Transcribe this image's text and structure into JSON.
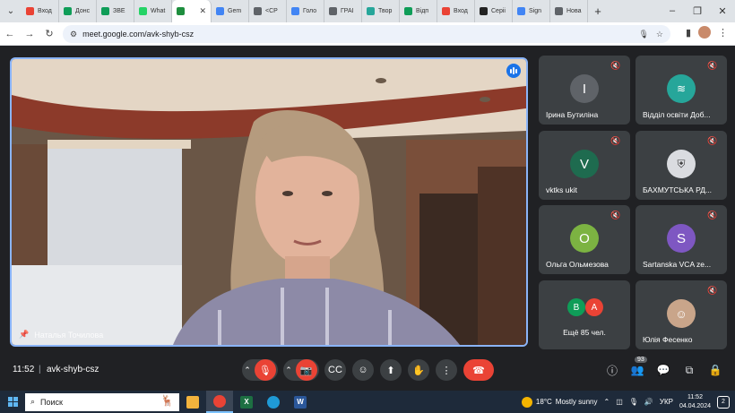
{
  "browser": {
    "tabs": [
      {
        "label": "Вход",
        "color": "#ea4335"
      },
      {
        "label": "Донс",
        "color": "#0f9d58"
      },
      {
        "label": "ЗВЕ",
        "color": "#0f9d58"
      },
      {
        "label": "What",
        "color": "#25d366"
      },
      {
        "label": "",
        "color": "#1e8e3e",
        "active": true
      },
      {
        "label": "Gem",
        "color": "#4285f4"
      },
      {
        "label": "<СР",
        "color": "#5f6368"
      },
      {
        "label": "Голо",
        "color": "#4285f4"
      },
      {
        "label": "ГРАІ",
        "color": "#5f6368"
      },
      {
        "label": "Твор",
        "color": "#26a69a"
      },
      {
        "label": "Відп",
        "color": "#0f9d58"
      },
      {
        "label": "Вход",
        "color": "#ea4335"
      },
      {
        "label": "Серіі",
        "color": "#222222"
      },
      {
        "label": "Sign",
        "color": "#4285f4"
      },
      {
        "label": "Нова",
        "color": "#5f6368"
      }
    ],
    "url": "meet.google.com/avk-shyb-csz"
  },
  "meeting": {
    "main_participant": "Наталья Точилова",
    "tiles": [
      {
        "name": "Ірина Бутиліна",
        "initial": "І",
        "color": "#5f6368"
      },
      {
        "name": "Відділ освіти Доб...",
        "initial": "",
        "color": "#26a69a"
      },
      {
        "name": "vktks ukit",
        "initial": "V",
        "color": "#1e6b4f"
      },
      {
        "name": "БАХМУТСЬКА РД...",
        "initial": "",
        "color": "#dadce0"
      },
      {
        "name": "Ольга Ольмезова",
        "initial": "О",
        "color": "#7cb342"
      },
      {
        "name": "Sartanska VCA ze...",
        "initial": "S",
        "color": "#7e57c2"
      },
      {
        "name": "Ещё 85 чел.",
        "initial": "",
        "color": ""
      },
      {
        "name": "Юлія Фесенко",
        "initial": "",
        "color": "#c9a58a"
      }
    ],
    "others_avatars": [
      {
        "initial": "В",
        "color": "#0f9d58"
      },
      {
        "initial": "А",
        "color": "#ea4335"
      }
    ],
    "time": "11:52",
    "separator": "|",
    "code": "avk-shyb-csz",
    "participant_count": "93"
  },
  "taskbar": {
    "search_placeholder": "Поиск",
    "temperature": "18°C",
    "weather": "Mostly sunny",
    "language": "УКР",
    "time": "11:52",
    "date": "04.04.2024",
    "notifications": "2"
  }
}
